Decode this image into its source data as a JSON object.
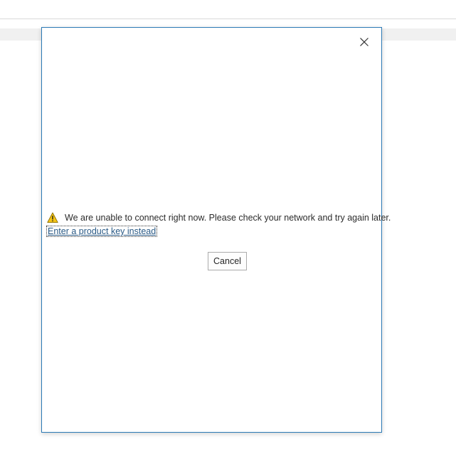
{
  "dialog": {
    "close_icon": "close-icon",
    "warning_icon": "warning-icon",
    "message": "We are unable to connect right now. Please check your network and try again later.",
    "link_label": "Enter a product key instead",
    "cancel_label": "Cancel"
  },
  "colors": {
    "dialog_border": "#2b79b5",
    "warning_fill": "#f5c518",
    "link": "#2a5a86"
  }
}
